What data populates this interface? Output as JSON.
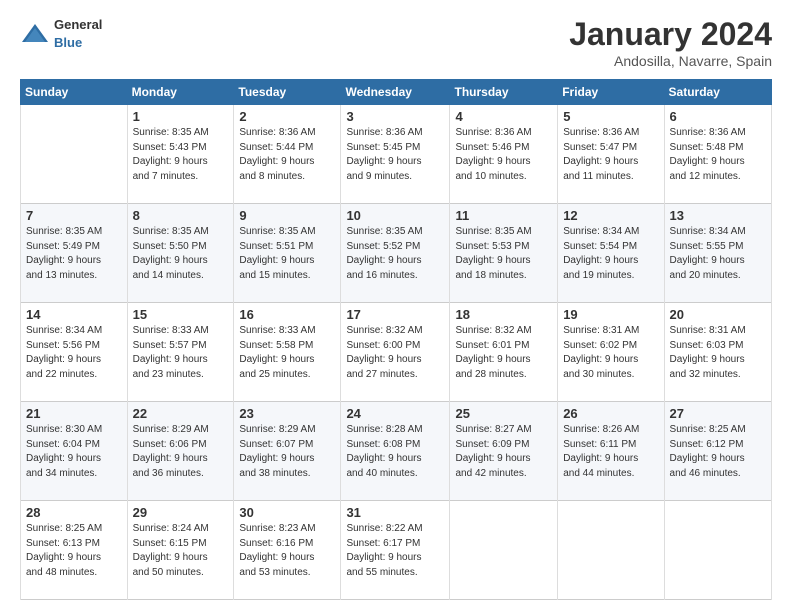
{
  "header": {
    "logo_general": "General",
    "logo_blue": "Blue",
    "title": "January 2024",
    "location": "Andosilla, Navarre, Spain"
  },
  "weekdays": [
    "Sunday",
    "Monday",
    "Tuesday",
    "Wednesday",
    "Thursday",
    "Friday",
    "Saturday"
  ],
  "weeks": [
    [
      {
        "day": "",
        "info": ""
      },
      {
        "day": "1",
        "info": "Sunrise: 8:35 AM\nSunset: 5:43 PM\nDaylight: 9 hours\nand 7 minutes."
      },
      {
        "day": "2",
        "info": "Sunrise: 8:36 AM\nSunset: 5:44 PM\nDaylight: 9 hours\nand 8 minutes."
      },
      {
        "day": "3",
        "info": "Sunrise: 8:36 AM\nSunset: 5:45 PM\nDaylight: 9 hours\nand 9 minutes."
      },
      {
        "day": "4",
        "info": "Sunrise: 8:36 AM\nSunset: 5:46 PM\nDaylight: 9 hours\nand 10 minutes."
      },
      {
        "day": "5",
        "info": "Sunrise: 8:36 AM\nSunset: 5:47 PM\nDaylight: 9 hours\nand 11 minutes."
      },
      {
        "day": "6",
        "info": "Sunrise: 8:36 AM\nSunset: 5:48 PM\nDaylight: 9 hours\nand 12 minutes."
      }
    ],
    [
      {
        "day": "7",
        "info": "Sunrise: 8:35 AM\nSunset: 5:49 PM\nDaylight: 9 hours\nand 13 minutes."
      },
      {
        "day": "8",
        "info": "Sunrise: 8:35 AM\nSunset: 5:50 PM\nDaylight: 9 hours\nand 14 minutes."
      },
      {
        "day": "9",
        "info": "Sunrise: 8:35 AM\nSunset: 5:51 PM\nDaylight: 9 hours\nand 15 minutes."
      },
      {
        "day": "10",
        "info": "Sunrise: 8:35 AM\nSunset: 5:52 PM\nDaylight: 9 hours\nand 16 minutes."
      },
      {
        "day": "11",
        "info": "Sunrise: 8:35 AM\nSunset: 5:53 PM\nDaylight: 9 hours\nand 18 minutes."
      },
      {
        "day": "12",
        "info": "Sunrise: 8:34 AM\nSunset: 5:54 PM\nDaylight: 9 hours\nand 19 minutes."
      },
      {
        "day": "13",
        "info": "Sunrise: 8:34 AM\nSunset: 5:55 PM\nDaylight: 9 hours\nand 20 minutes."
      }
    ],
    [
      {
        "day": "14",
        "info": "Sunrise: 8:34 AM\nSunset: 5:56 PM\nDaylight: 9 hours\nand 22 minutes."
      },
      {
        "day": "15",
        "info": "Sunrise: 8:33 AM\nSunset: 5:57 PM\nDaylight: 9 hours\nand 23 minutes."
      },
      {
        "day": "16",
        "info": "Sunrise: 8:33 AM\nSunset: 5:58 PM\nDaylight: 9 hours\nand 25 minutes."
      },
      {
        "day": "17",
        "info": "Sunrise: 8:32 AM\nSunset: 6:00 PM\nDaylight: 9 hours\nand 27 minutes."
      },
      {
        "day": "18",
        "info": "Sunrise: 8:32 AM\nSunset: 6:01 PM\nDaylight: 9 hours\nand 28 minutes."
      },
      {
        "day": "19",
        "info": "Sunrise: 8:31 AM\nSunset: 6:02 PM\nDaylight: 9 hours\nand 30 minutes."
      },
      {
        "day": "20",
        "info": "Sunrise: 8:31 AM\nSunset: 6:03 PM\nDaylight: 9 hours\nand 32 minutes."
      }
    ],
    [
      {
        "day": "21",
        "info": "Sunrise: 8:30 AM\nSunset: 6:04 PM\nDaylight: 9 hours\nand 34 minutes."
      },
      {
        "day": "22",
        "info": "Sunrise: 8:29 AM\nSunset: 6:06 PM\nDaylight: 9 hours\nand 36 minutes."
      },
      {
        "day": "23",
        "info": "Sunrise: 8:29 AM\nSunset: 6:07 PM\nDaylight: 9 hours\nand 38 minutes."
      },
      {
        "day": "24",
        "info": "Sunrise: 8:28 AM\nSunset: 6:08 PM\nDaylight: 9 hours\nand 40 minutes."
      },
      {
        "day": "25",
        "info": "Sunrise: 8:27 AM\nSunset: 6:09 PM\nDaylight: 9 hours\nand 42 minutes."
      },
      {
        "day": "26",
        "info": "Sunrise: 8:26 AM\nSunset: 6:11 PM\nDaylight: 9 hours\nand 44 minutes."
      },
      {
        "day": "27",
        "info": "Sunrise: 8:25 AM\nSunset: 6:12 PM\nDaylight: 9 hours\nand 46 minutes."
      }
    ],
    [
      {
        "day": "28",
        "info": "Sunrise: 8:25 AM\nSunset: 6:13 PM\nDaylight: 9 hours\nand 48 minutes."
      },
      {
        "day": "29",
        "info": "Sunrise: 8:24 AM\nSunset: 6:15 PM\nDaylight: 9 hours\nand 50 minutes."
      },
      {
        "day": "30",
        "info": "Sunrise: 8:23 AM\nSunset: 6:16 PM\nDaylight: 9 hours\nand 53 minutes."
      },
      {
        "day": "31",
        "info": "Sunrise: 8:22 AM\nSunset: 6:17 PM\nDaylight: 9 hours\nand 55 minutes."
      },
      {
        "day": "",
        "info": ""
      },
      {
        "day": "",
        "info": ""
      },
      {
        "day": "",
        "info": ""
      }
    ]
  ]
}
